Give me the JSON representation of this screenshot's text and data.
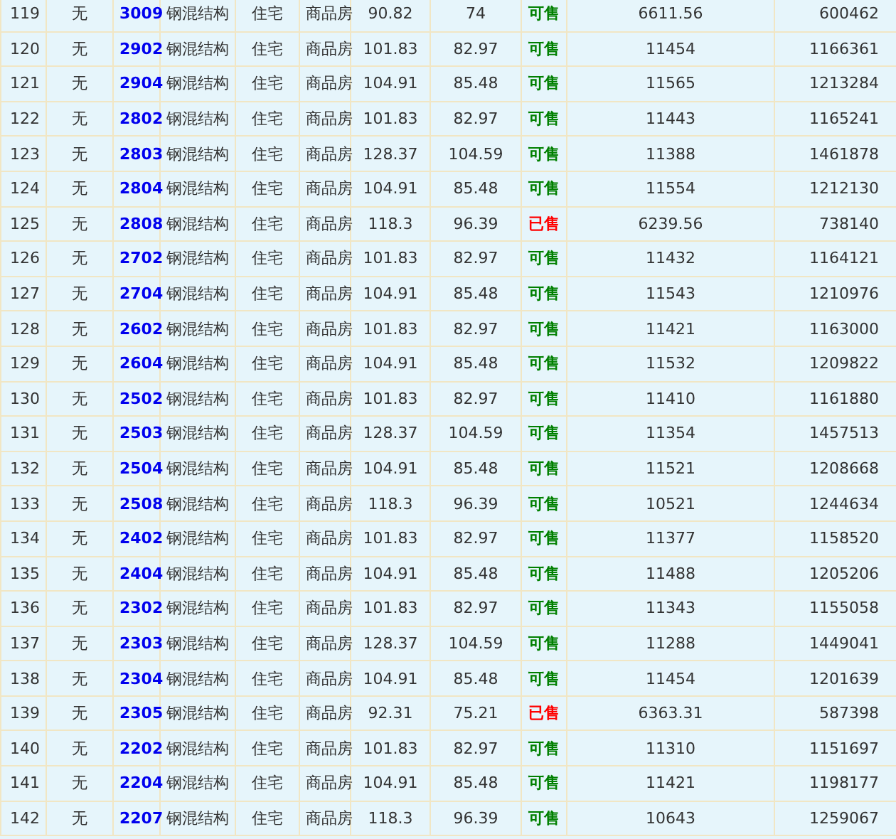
{
  "rows": [
    {
      "cells": [
        "119",
        "无",
        "3009",
        "钢混结构",
        "住宅",
        "商品房",
        "90.82",
        "74",
        "可售",
        "6611.56",
        "600462"
      ],
      "kind": "available"
    },
    {
      "cells": [
        "120",
        "无",
        "2902",
        "钢混结构",
        "住宅",
        "商品房",
        "101.83",
        "82.97",
        "可售",
        "11454",
        "1166361"
      ],
      "kind": "available"
    },
    {
      "cells": [
        "121",
        "无",
        "2904",
        "钢混结构",
        "住宅",
        "商品房",
        "104.91",
        "85.48",
        "可售",
        "11565",
        "1213284"
      ],
      "kind": "available"
    },
    {
      "cells": [
        "122",
        "无",
        "2802",
        "钢混结构",
        "住宅",
        "商品房",
        "101.83",
        "82.97",
        "可售",
        "11443",
        "1165241"
      ],
      "kind": "available"
    },
    {
      "cells": [
        "123",
        "无",
        "2803",
        "钢混结构",
        "住宅",
        "商品房",
        "128.37",
        "104.59",
        "可售",
        "11388",
        "1461878"
      ],
      "kind": "available"
    },
    {
      "cells": [
        "124",
        "无",
        "2804",
        "钢混结构",
        "住宅",
        "商品房",
        "104.91",
        "85.48",
        "可售",
        "11554",
        "1212130"
      ],
      "kind": "available"
    },
    {
      "cells": [
        "125",
        "无",
        "2808",
        "钢混结构",
        "住宅",
        "商品房",
        "118.3",
        "96.39",
        "已售",
        "6239.56",
        "738140"
      ],
      "kind": "sold"
    },
    {
      "cells": [
        "126",
        "无",
        "2702",
        "钢混结构",
        "住宅",
        "商品房",
        "101.83",
        "82.97",
        "可售",
        "11432",
        "1164121"
      ],
      "kind": "available"
    },
    {
      "cells": [
        "127",
        "无",
        "2704",
        "钢混结构",
        "住宅",
        "商品房",
        "104.91",
        "85.48",
        "可售",
        "11543",
        "1210976"
      ],
      "kind": "available"
    },
    {
      "cells": [
        "128",
        "无",
        "2602",
        "钢混结构",
        "住宅",
        "商品房",
        "101.83",
        "82.97",
        "可售",
        "11421",
        "1163000"
      ],
      "kind": "available"
    },
    {
      "cells": [
        "129",
        "无",
        "2604",
        "钢混结构",
        "住宅",
        "商品房",
        "104.91",
        "85.48",
        "可售",
        "11532",
        "1209822"
      ],
      "kind": "available"
    },
    {
      "cells": [
        "130",
        "无",
        "2502",
        "钢混结构",
        "住宅",
        "商品房",
        "101.83",
        "82.97",
        "可售",
        "11410",
        "1161880"
      ],
      "kind": "available"
    },
    {
      "cells": [
        "131",
        "无",
        "2503",
        "钢混结构",
        "住宅",
        "商品房",
        "128.37",
        "104.59",
        "可售",
        "11354",
        "1457513"
      ],
      "kind": "available"
    },
    {
      "cells": [
        "132",
        "无",
        "2504",
        "钢混结构",
        "住宅",
        "商品房",
        "104.91",
        "85.48",
        "可售",
        "11521",
        "1208668"
      ],
      "kind": "available"
    },
    {
      "cells": [
        "133",
        "无",
        "2508",
        "钢混结构",
        "住宅",
        "商品房",
        "118.3",
        "96.39",
        "可售",
        "10521",
        "1244634"
      ],
      "kind": "available"
    },
    {
      "cells": [
        "134",
        "无",
        "2402",
        "钢混结构",
        "住宅",
        "商品房",
        "101.83",
        "82.97",
        "可售",
        "11377",
        "1158520"
      ],
      "kind": "available"
    },
    {
      "cells": [
        "135",
        "无",
        "2404",
        "钢混结构",
        "住宅",
        "商品房",
        "104.91",
        "85.48",
        "可售",
        "11488",
        "1205206"
      ],
      "kind": "available"
    },
    {
      "cells": [
        "136",
        "无",
        "2302",
        "钢混结构",
        "住宅",
        "商品房",
        "101.83",
        "82.97",
        "可售",
        "11343",
        "1155058"
      ],
      "kind": "available"
    },
    {
      "cells": [
        "137",
        "无",
        "2303",
        "钢混结构",
        "住宅",
        "商品房",
        "128.37",
        "104.59",
        "可售",
        "11288",
        "1449041"
      ],
      "kind": "available"
    },
    {
      "cells": [
        "138",
        "无",
        "2304",
        "钢混结构",
        "住宅",
        "商品房",
        "104.91",
        "85.48",
        "可售",
        "11454",
        "1201639"
      ],
      "kind": "available"
    },
    {
      "cells": [
        "139",
        "无",
        "2305",
        "钢混结构",
        "住宅",
        "商品房",
        "92.31",
        "75.21",
        "已售",
        "6363.31",
        "587398"
      ],
      "kind": "sold"
    },
    {
      "cells": [
        "140",
        "无",
        "2202",
        "钢混结构",
        "住宅",
        "商品房",
        "101.83",
        "82.97",
        "可售",
        "11310",
        "1151697"
      ],
      "kind": "available"
    },
    {
      "cells": [
        "141",
        "无",
        "2204",
        "钢混结构",
        "住宅",
        "商品房",
        "104.91",
        "85.48",
        "可售",
        "11421",
        "1198177"
      ],
      "kind": "available"
    },
    {
      "cells": [
        "142",
        "无",
        "2207",
        "钢混结构",
        "住宅",
        "商品房",
        "118.3",
        "96.39",
        "可售",
        "10643",
        "1259067"
      ],
      "kind": "available"
    }
  ]
}
